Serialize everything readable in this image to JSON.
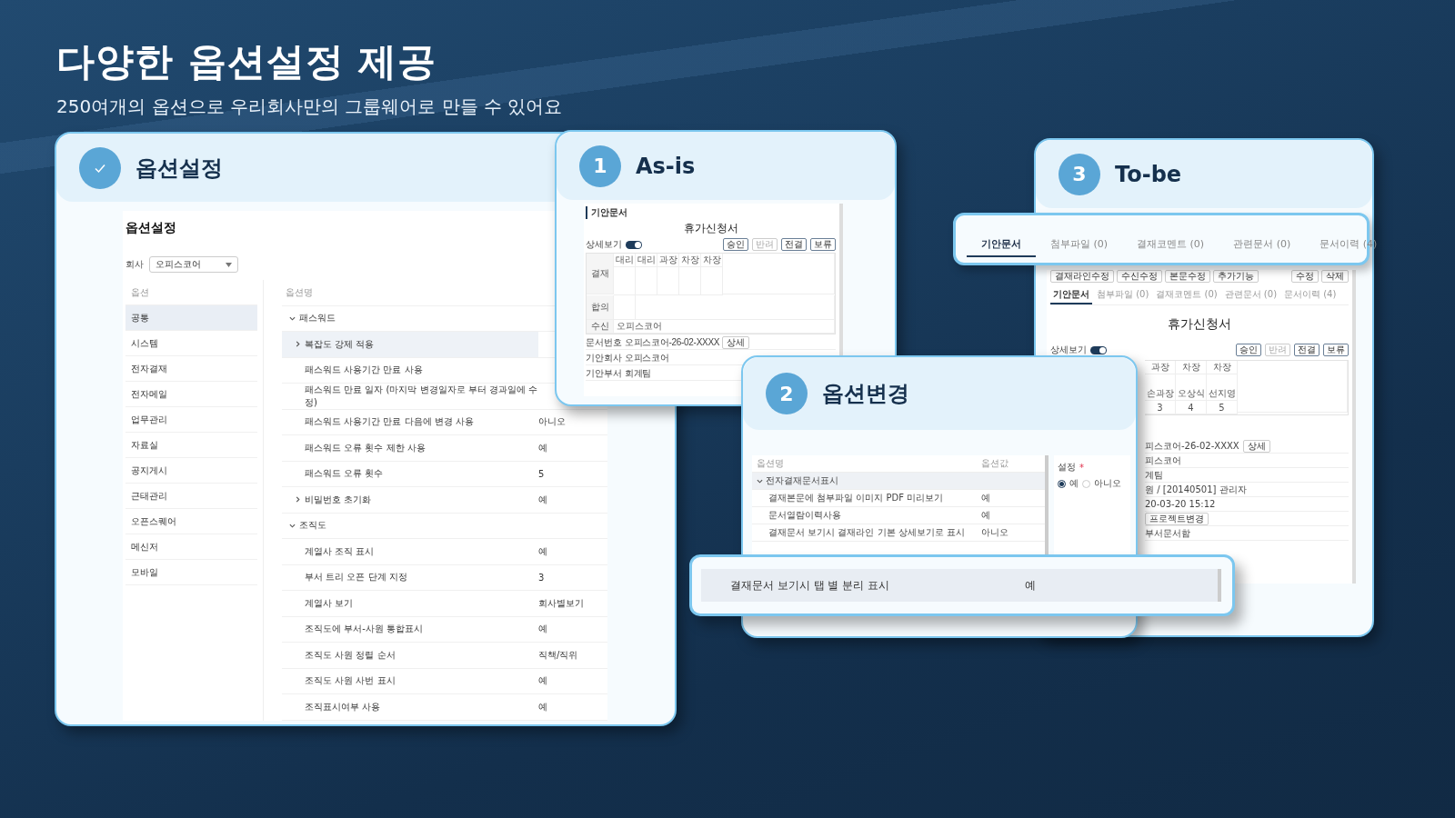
{
  "heading": {
    "title": "다양한 옵션설정 제공",
    "subtitle": "250여개의 옵션으로 우리회사만의 그룹웨어로 만들 수 있어요"
  },
  "settings_card": {
    "title": "옵션설정",
    "screen": {
      "title": "옵션설정",
      "company_label": "회사",
      "company_value": "오피스코어",
      "category_header": "옵션",
      "categories": [
        {
          "label": "공통",
          "selected": true
        },
        {
          "label": "시스템",
          "selected": false
        },
        {
          "label": "전자결재",
          "selected": false
        },
        {
          "label": "전자메일",
          "selected": false
        },
        {
          "label": "업무관리",
          "selected": false
        },
        {
          "label": "자료실",
          "selected": false
        },
        {
          "label": "공지게시",
          "selected": false
        },
        {
          "label": "근태관리",
          "selected": false
        },
        {
          "label": "오픈스퀘어",
          "selected": false
        },
        {
          "label": "메신저",
          "selected": false
        },
        {
          "label": "모바일",
          "selected": false
        }
      ],
      "table_header": "옵션명",
      "options": [
        {
          "label": "패스워드",
          "expanded": true,
          "selected": false,
          "children": [
            {
              "label": "복잡도 강제 적용",
              "expanded": false,
              "selected": true
            },
            {
              "label": "패스워드 사용기간 만료 사용",
              "selected": false
            },
            {
              "label": "패스워드 만료 일자 (마지막 변경일자로 부터 경과일에 수정)",
              "selected": false
            },
            {
              "label": "패스워드 사용기간 만료 다음에 변경 사용",
              "value": "아니오",
              "selected": false
            },
            {
              "label": "패스워드 오류 횟수 제한 사용",
              "value": "예",
              "selected": false
            },
            {
              "label": "패스워드 오류 횟수",
              "value": "5",
              "selected": false
            },
            {
              "label": "비밀번호 초기화",
              "expanded": false,
              "value": "예",
              "selected": false
            }
          ]
        },
        {
          "label": "조직도",
          "expanded": true,
          "selected": false,
          "children": [
            {
              "label": "계열사 조직 표시",
              "value": "예",
              "selected": false
            },
            {
              "label": "부서 트리 오픈 단계 지정",
              "value": "3",
              "selected": false
            },
            {
              "label": "계열사 보기",
              "value": "회사별보기",
              "selected": false
            },
            {
              "label": "조직도에 부서-사원 통합표시",
              "value": "예",
              "selected": false
            },
            {
              "label": "조직도 사원 정렬 순서",
              "value": "직책/직위",
              "selected": false
            },
            {
              "label": "조직도 사원 사번 표시",
              "value": "예",
              "selected": false
            },
            {
              "label": "조직표시여부 사용",
              "value": "예",
              "selected": false
            }
          ]
        }
      ]
    }
  },
  "asis_card": {
    "number": "1",
    "title": "As-is",
    "screen": {
      "section": "기안문서",
      "doc_title": "휴가신청서",
      "detail_label": "상세보기",
      "detail_on": true,
      "actions": [
        {
          "label": "승인",
          "disabled": false
        },
        {
          "label": "반려",
          "disabled": true
        },
        {
          "label": "전결",
          "disabled": false
        },
        {
          "label": "보류",
          "disabled": false
        }
      ],
      "approval_label": "결재",
      "positions": [
        "대리",
        "대리",
        "과장",
        "차장",
        "차장"
      ],
      "agreement_label": "합의",
      "recipient_label": "수신",
      "recipient_value": "오피스코어",
      "info": [
        {
          "label": "문서번호",
          "value": "오피스코어-26-02-XXXX",
          "button": "상세"
        },
        {
          "label": "기안회사",
          "value": "오피스코어"
        },
        {
          "label": "기안부서",
          "value": "회계팀"
        }
      ]
    }
  },
  "change_card": {
    "number": "2",
    "title": "옵션변경",
    "columns": [
      "옵션명",
      "옵션값"
    ],
    "group": {
      "label": "전자결재문서표시",
      "expanded": true,
      "selected": true,
      "children": [
        {
          "label": "결재본문에 첨부파일 이미지 PDF 미리보기",
          "value": "예",
          "selected": false
        },
        {
          "label": "문서열람이력사용",
          "value": "예",
          "selected": false
        },
        {
          "label": "결재문서 보기시 결재라인 기본 상세보기로 표시",
          "value": "아니오",
          "selected": false
        }
      ]
    },
    "setting": {
      "label": "설정",
      "required_mark": "*",
      "options": [
        {
          "label": "예",
          "selected": true
        },
        {
          "label": "아니오",
          "selected": false
        }
      ]
    },
    "highlight": {
      "label": "결재문서 보기시 탭 별 분리 표시",
      "value": "예"
    }
  },
  "tobe_card": {
    "number": "3",
    "title": "To-be",
    "callout_tabs": [
      {
        "label": "기안문서",
        "selected": true
      },
      {
        "label": "첨부파일 (0)",
        "selected": false
      },
      {
        "label": "결재코멘트 (0)",
        "selected": false
      },
      {
        "label": "관련문서 (0)",
        "selected": false
      },
      {
        "label": "문서이력 (4)",
        "selected": false
      }
    ],
    "screen": {
      "toolbar": [
        "결재라인수정",
        "수신수정",
        "본문수정"
      ],
      "more_menu": "추가기능",
      "toolbar_right": [
        "수정",
        "삭제"
      ],
      "tabs": [
        {
          "label": "기안문서",
          "selected": true
        },
        {
          "label": "첨부파일 (0)",
          "selected": false
        },
        {
          "label": "결재코멘트 (0)",
          "selected": false
        },
        {
          "label": "관련문서 (0)",
          "selected": false
        },
        {
          "label": "문서이력 (4)",
          "selected": false
        }
      ],
      "doc_title": "휴가신청서",
      "detail_label": "상세보기",
      "detail_on": true,
      "actions": [
        {
          "label": "승인",
          "disabled": false
        },
        {
          "label": "반려",
          "disabled": true
        },
        {
          "label": "전결",
          "disabled": false
        },
        {
          "label": "보류",
          "disabled": false
        }
      ],
      "approvers": [
        {
          "position": "과장",
          "name": "손과장",
          "order": "3"
        },
        {
          "position": "차장",
          "name": "오상식",
          "order": "4"
        },
        {
          "position": "차장",
          "name": "선지영",
          "order": "5"
        }
      ],
      "info": [
        {
          "value": "피스코어-26-02-XXXX",
          "button": "상세"
        },
        {
          "value": "피스코어"
        },
        {
          "value": "계팀"
        },
        {
          "value": "원 / [20140501] 관리자"
        },
        {
          "value": "20-03-20 15:12"
        },
        {
          "button": "프로젝트변경"
        },
        {
          "value": "부서문서함"
        }
      ]
    }
  }
}
